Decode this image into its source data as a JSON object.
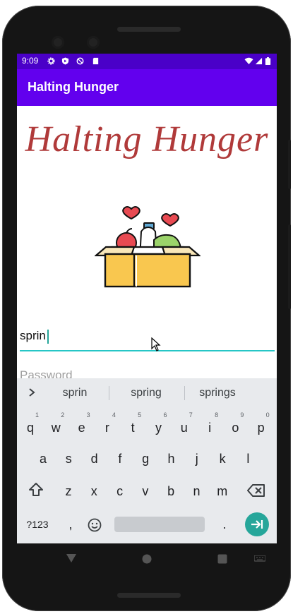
{
  "statusbar": {
    "time": "9:09"
  },
  "appbar": {
    "title": "Halting Hunger"
  },
  "logo": {
    "text": "Halting Hunger"
  },
  "form": {
    "username_value": "sprin",
    "password_placeholder": "Password"
  },
  "keyboard": {
    "suggestions": [
      "sprin",
      "spring",
      "springs"
    ],
    "row1": [
      "q",
      "w",
      "e",
      "r",
      "t",
      "y",
      "u",
      "i",
      "o",
      "p"
    ],
    "row1_hints": [
      "1",
      "2",
      "3",
      "4",
      "5",
      "6",
      "7",
      "8",
      "9",
      "0"
    ],
    "row2": [
      "a",
      "s",
      "d",
      "f",
      "g",
      "h",
      "j",
      "k",
      "l"
    ],
    "row3": [
      "z",
      "x",
      "c",
      "v",
      "b",
      "n",
      "m"
    ],
    "symbols_label": "?123",
    "comma": ",",
    "period": "."
  },
  "colors": {
    "statusbar": "#4a00c8",
    "appbar": "#6200ee",
    "accent": "#26a69a",
    "logo": "#b03a3a"
  }
}
